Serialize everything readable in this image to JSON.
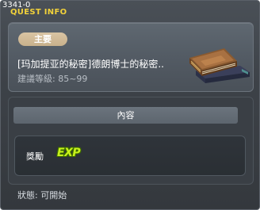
{
  "window": {
    "quest_id": "3341-0",
    "title": "QUEST INFO"
  },
  "header": {
    "tag": "主要",
    "quest_name": "[玛加提亚的秘密]德朗博士的秘密..",
    "level_text": "建議等級: 85~99",
    "icon": "book-icon"
  },
  "content": {
    "header_label": "內容",
    "reward_label": "獎勵",
    "reward_icon": "exp-icon",
    "reward_icon_text": "EXP"
  },
  "status": {
    "text": "狀態: 可開始"
  },
  "colors": {
    "title": "#f2d23a",
    "tag_bg": "#d9c4a3",
    "exp": "#c8f21c"
  }
}
